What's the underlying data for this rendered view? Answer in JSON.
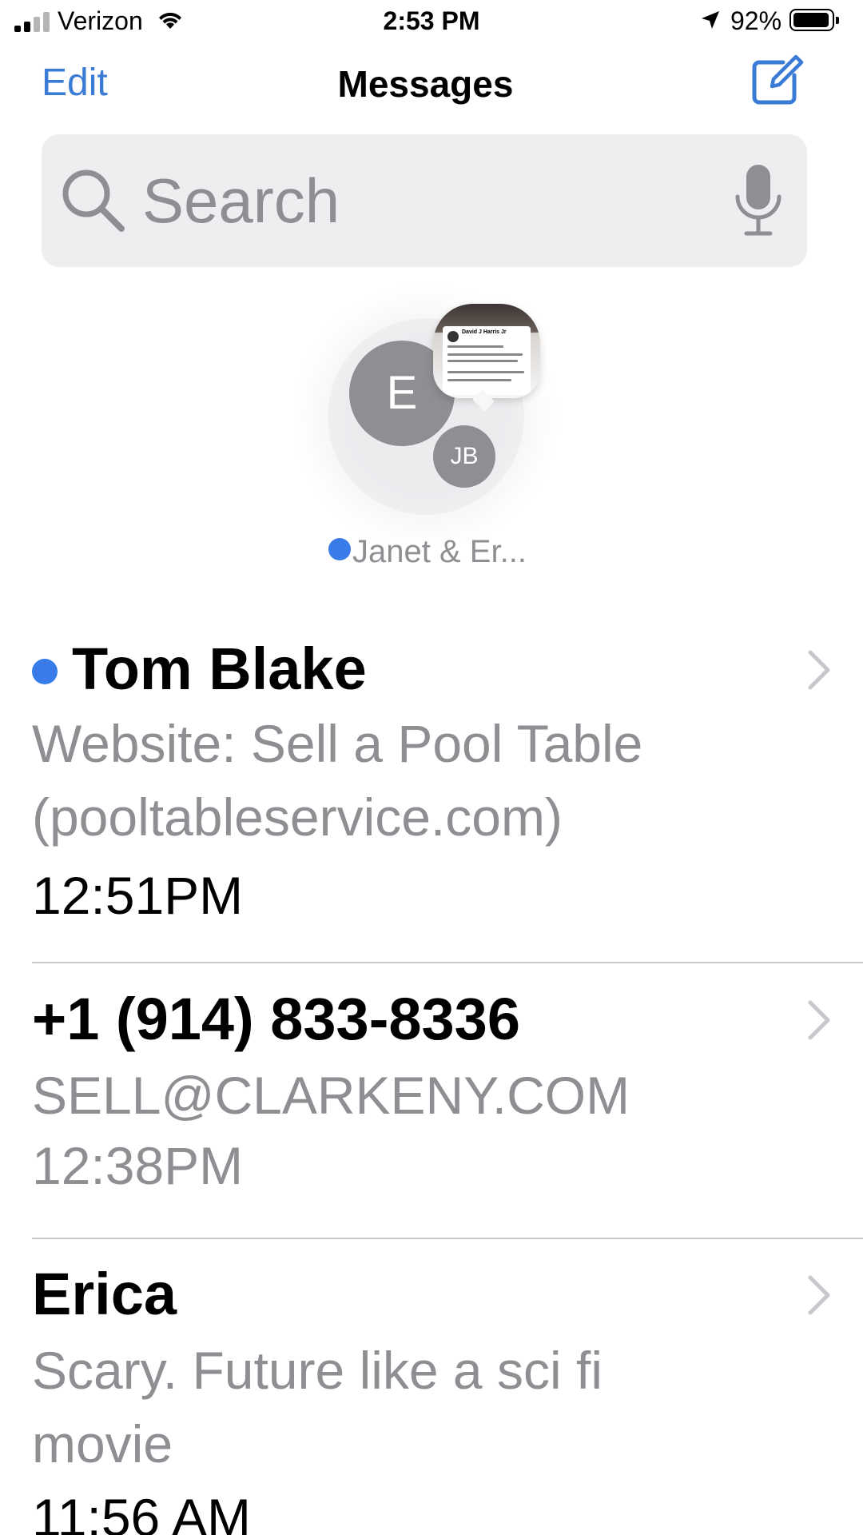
{
  "status_bar": {
    "carrier": "Verizon",
    "time": "2:53 PM",
    "battery_percent": "92%",
    "battery_level": 0.92,
    "signal_bars": 2,
    "icons": [
      "signal-icon",
      "wifi-icon",
      "location-arrow-icon",
      "battery-icon"
    ]
  },
  "nav": {
    "edit_label": "Edit",
    "title": "Messages",
    "compose_icon": "compose-icon"
  },
  "search": {
    "placeholder": "Search",
    "icons": [
      "search-icon",
      "mic-icon"
    ]
  },
  "pinned": {
    "name": "Janet & Er...",
    "unread": true,
    "avatars": [
      "E",
      "JB"
    ],
    "preview_post_author": "David J Harris Jr"
  },
  "conversations": [
    {
      "name": "Tom Blake",
      "unread": true,
      "preview": "Website: Sell a Pool Table (pooltableservice.com)",
      "time": "12:51PM"
    },
    {
      "name": "+1 (914) 833-8336",
      "unread": false,
      "preview": "SELL@CLARKENY.COM",
      "time": "12:38PM"
    },
    {
      "name": "Erica",
      "unread": false,
      "preview": "Scary. Future like a sci fi movie",
      "time": "11:56 AM"
    }
  ],
  "colors": {
    "accent": "#3a7bd5",
    "unread_dot": "#3a7bea",
    "secondary_text": "#8e8e93",
    "search_background": "#eeeef0",
    "avatar_gray": "#8e8e93"
  }
}
